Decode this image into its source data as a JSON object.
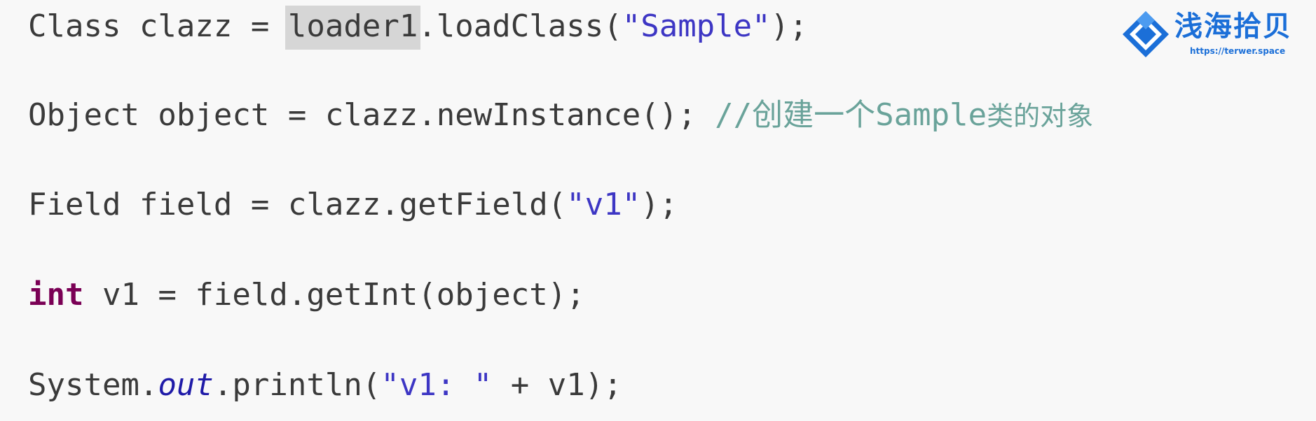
{
  "code": {
    "line1": {
      "part1": "Class clazz = ",
      "highlighted": "loader1",
      "part2": ".loadClass(",
      "string": "\"Sample\"",
      "part3": ");"
    },
    "line2": {
      "part1": "Object object = clazz.newInstance(); ",
      "comment_prefix": "//创建一个",
      "comment_code": "Sample",
      "comment_suffix": "类的对象"
    },
    "line3": {
      "part1": "Field field = clazz.getField(",
      "string": "\"v1\"",
      "part2": ");"
    },
    "line4": {
      "keyword": "int",
      "part1": " v1 = field.getInt(object);"
    },
    "line5": {
      "part1": "System.",
      "field": "out",
      "part2": ".println(",
      "string": "\"v1: \"",
      "part3": " + v1);"
    }
  },
  "watermark": {
    "title": "浅海拾贝",
    "url": "https://terwer.space",
    "icon": "diamond-logo-icon"
  },
  "colors": {
    "background": "#f8f8f8",
    "text": "#3a3a3a",
    "string": "#3d36c4",
    "keyword": "#7a0055",
    "comment": "#6aa39a",
    "highlight": "#d6d6d6",
    "brand": "#1b6fd8"
  }
}
